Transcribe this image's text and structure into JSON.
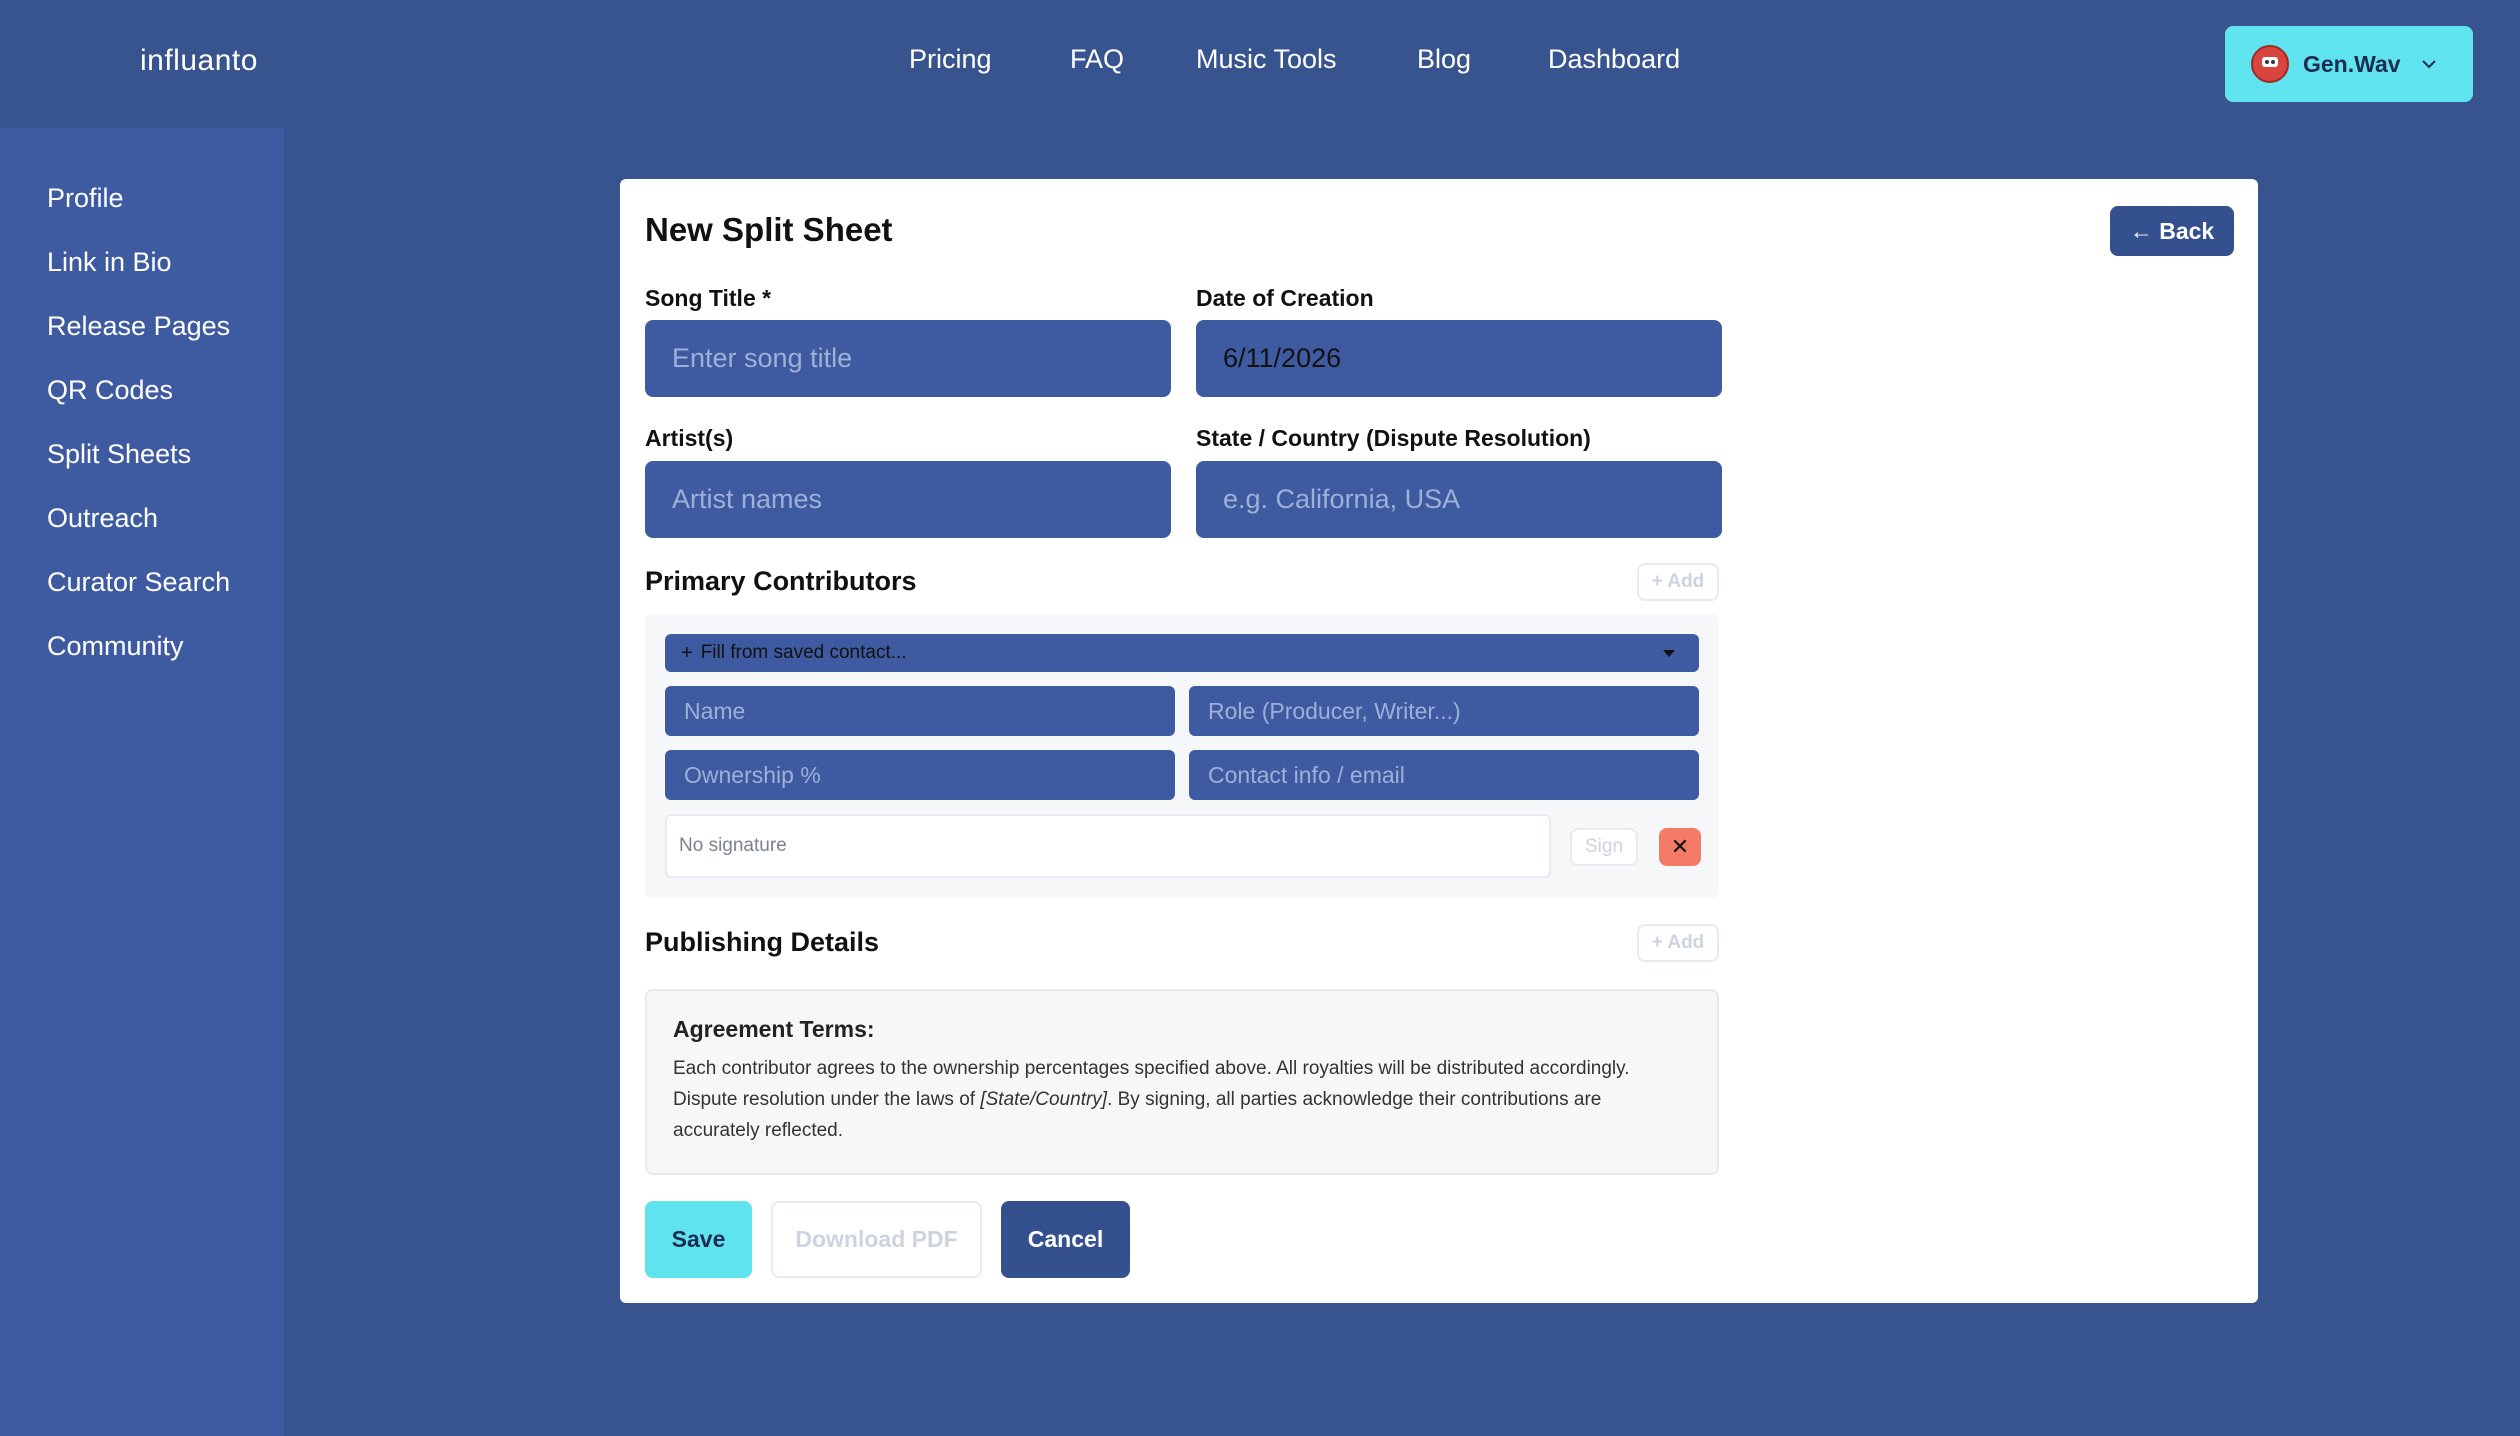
{
  "brand": {
    "logo": "influanto"
  },
  "nav": [
    "Pricing",
    "FAQ",
    "Music Tools",
    "Blog",
    "Dashboard"
  ],
  "user": {
    "name": "Gen.Wav",
    "avatar_icon": "avatar-icon"
  },
  "sidebar": [
    "Profile",
    "Link in Bio",
    "Release Pages",
    "QR Codes",
    "Split Sheets",
    "Outreach",
    "Curator Search",
    "Community"
  ],
  "form": {
    "title": "New Split Sheet",
    "back_label": "← Back",
    "song_title_label": "Song Title *",
    "song_title_placeholder": "Enter song title",
    "date_label": "Date of Creation",
    "date_value": "6/11/2026",
    "artists_label": "Artist(s)",
    "artists_placeholder": "Artist names",
    "state_label": "State / Country (Dispute Resolution)",
    "state_placeholder": "e.g. California, USA"
  },
  "contributors": {
    "title": "Primary Contributors",
    "add_label": "+ Add",
    "saved_contact_label": "Fill from saved contact...",
    "name_placeholder": "Name",
    "role_placeholder": "Role (Producer, Writer...)",
    "ownership_placeholder": "Ownership %",
    "contact_placeholder": "Contact info / email",
    "signature_status": "No signature",
    "sign_label": "Sign",
    "remove_icon": "✕"
  },
  "publishing": {
    "title": "Publishing Details",
    "add_label": "+ Add"
  },
  "terms": {
    "title": "Agreement Terms:",
    "text_before": "Each contributor agrees to the ownership percentages specified above. All royalties will be distributed accordingly. Dispute resolution under the laws of ",
    "placeholder": "[State/Country]",
    "text_after": ". By signing, all parties acknowledge their contributions are accurately reflected."
  },
  "actions": {
    "save": "Save",
    "download": "Download PDF",
    "cancel": "Cancel"
  },
  "colors": {
    "background": "#38548f",
    "sidebar": "#3e5ba2",
    "accent": "#5fe3ee",
    "input": "#3e5ba2",
    "danger": "#f27a66",
    "button_dark": "#34508f"
  }
}
